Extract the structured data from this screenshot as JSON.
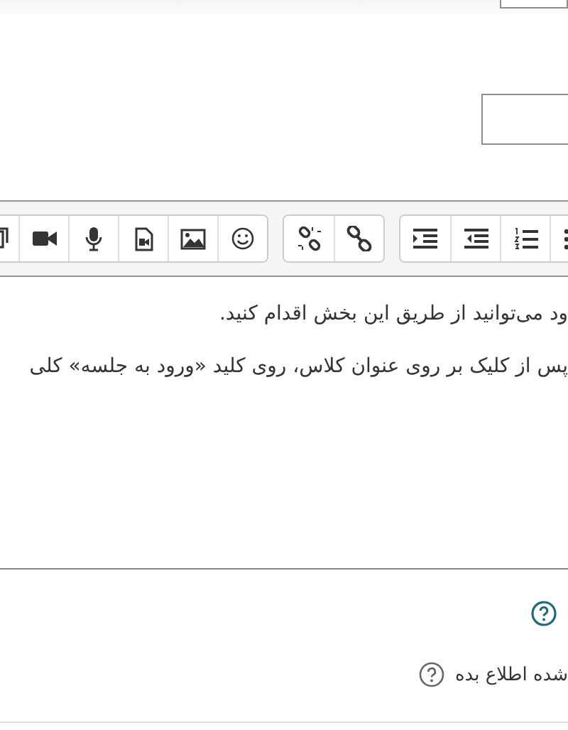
{
  "editor": {
    "paragraphs": [
      "ود می‌توانید از طریق این بخش اقدام کنید.",
      "پس از کلیک بر روی عنوان کلاس، روی کلید «ورود به جلسه» کلی"
    ]
  },
  "notify_option": {
    "label": "شده اطلاع بده"
  }
}
